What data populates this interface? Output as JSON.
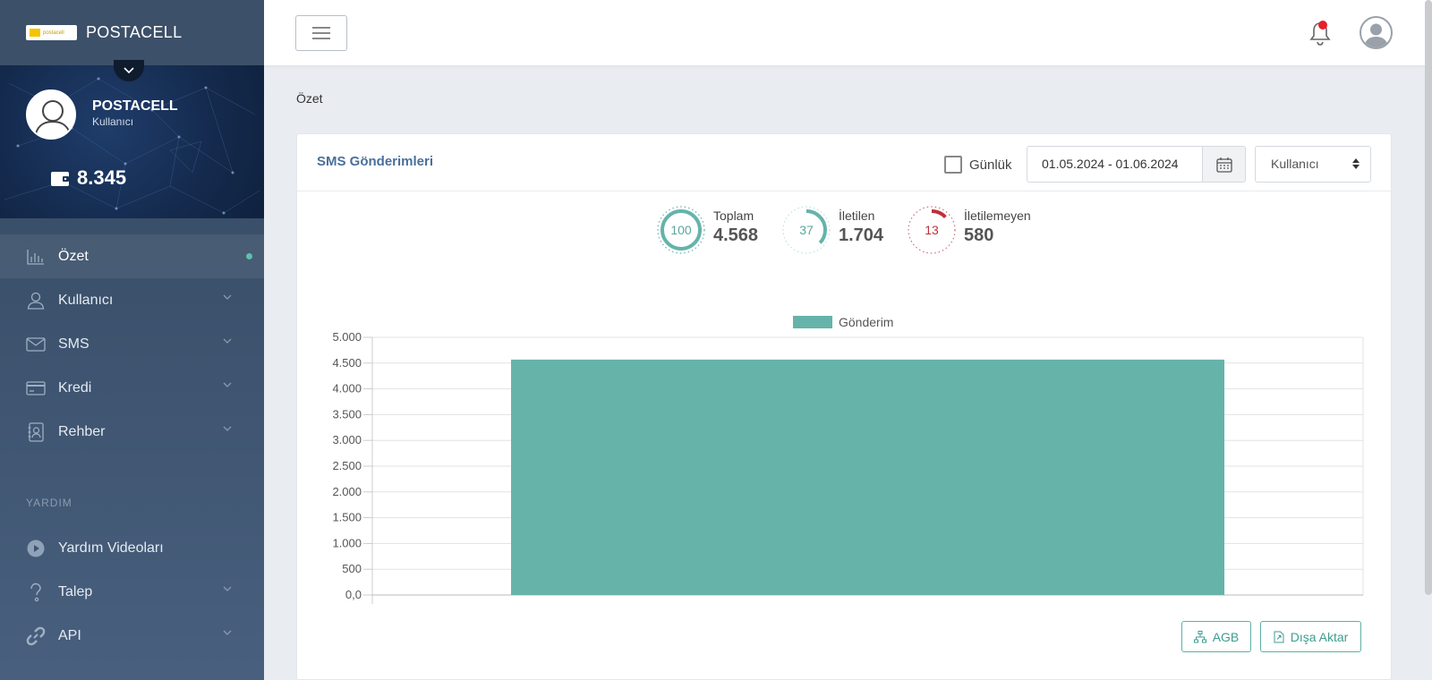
{
  "brand": {
    "name": "POSTACELL",
    "logo_text": "postacell"
  },
  "profile": {
    "name": "POSTACELL",
    "role": "Kullanıcı",
    "balance": "8.345"
  },
  "sidebar": {
    "items": [
      {
        "label": "Özet",
        "icon": "bar-chart-icon",
        "active": true
      },
      {
        "label": "Kullanıcı",
        "icon": "user-icon"
      },
      {
        "label": "SMS",
        "icon": "envelope-icon"
      },
      {
        "label": "Kredi",
        "icon": "credit-card-icon"
      },
      {
        "label": "Rehber",
        "icon": "contact-book-icon"
      }
    ],
    "section_label": "YARDIM",
    "help_items": [
      {
        "label": "Yardım Videoları",
        "icon": "play-circle-icon"
      },
      {
        "label": "Talep",
        "icon": "question-icon"
      },
      {
        "label": "API",
        "icon": "link-icon"
      }
    ]
  },
  "page": {
    "title": "Özet"
  },
  "card": {
    "title": "SMS Gönderimleri",
    "daily_label": "Günlük",
    "date_range": "01.05.2024 - 01.06.2024",
    "user_select": "Kullanıcı",
    "stats": [
      {
        "label": "Toplam",
        "value": "4.568",
        "percent": "100",
        "color": "#66b3aa"
      },
      {
        "label": "İletilen",
        "value": "1.704",
        "percent": "37",
        "color": "#66b3aa"
      },
      {
        "label": "İletilemeyen",
        "value": "580",
        "percent": "13",
        "color": "#c0303a"
      }
    ],
    "buttons": {
      "agb": "AGB",
      "export": "Dışa Aktar"
    }
  },
  "chart_data": {
    "type": "bar",
    "categories": [
      ""
    ],
    "series": [
      {
        "name": "Gönderim",
        "values": [
          4568
        ],
        "color": "#66b3aa"
      }
    ],
    "ylim": [
      0,
      5000
    ],
    "yticks": [
      "0,0",
      "500",
      "1.000",
      "1.500",
      "2.000",
      "2.500",
      "3.000",
      "3.500",
      "4.000",
      "4.500",
      "5.000"
    ],
    "legend": "top-center",
    "grid": true
  }
}
